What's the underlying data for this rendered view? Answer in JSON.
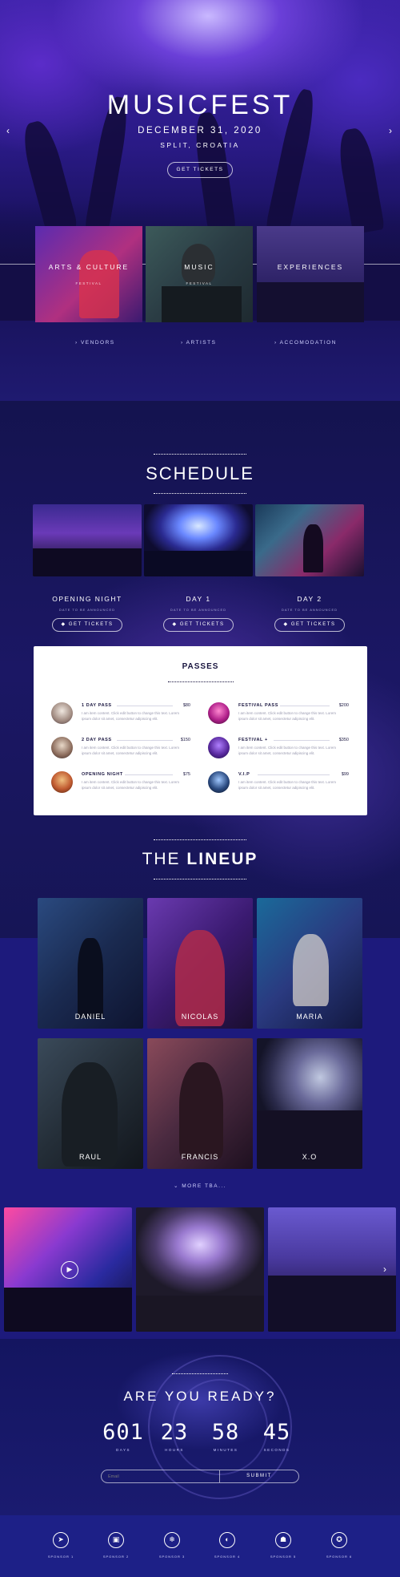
{
  "hero": {
    "title": "MUSICFEST",
    "date": "DECEMBER 31, 2020",
    "location": "SPLIT, CROATIA",
    "cta": "GET TICKETS",
    "prev_icon": "chevron-left-icon",
    "next_icon": "chevron-right-icon"
  },
  "categories": [
    {
      "label": "ARTS & CULTURE",
      "sub": "FESTIVAL"
    },
    {
      "label": "MUSIC",
      "sub": "FESTIVAL"
    },
    {
      "label": "EXPERIENCES",
      "sub": ""
    }
  ],
  "nav_links": [
    {
      "label": "› VENDORS"
    },
    {
      "label": "› ARTISTS"
    },
    {
      "label": "› ACCOMODATION"
    }
  ],
  "schedule": {
    "title": "SCHEDULE",
    "days": [
      {
        "title": "OPENING NIGHT",
        "sub": "DATE TO BE ANNOUNCED",
        "btn": "GET TICKETS"
      },
      {
        "title": "DAY 1",
        "sub": "DATE TO BE ANNOUNCED",
        "btn": "GET TICKETS"
      },
      {
        "title": "DAY 2",
        "sub": "DATE TO BE ANNOUNCED",
        "btn": "GET TICKETS"
      }
    ]
  },
  "passes": {
    "title": "PASSES",
    "items": [
      {
        "name": "1 DAY PASS",
        "price": "$80",
        "desc": "I am item content. Click edit button to change this text. Lorem ipsum dolor sit amet, consectetur adipiscing elit."
      },
      {
        "name": "FESTIVAL PASS",
        "price": "$200",
        "desc": "I am item content. Click edit button to change this text. Lorem ipsum dolor sit amet, consectetur adipiscing elit."
      },
      {
        "name": "2 DAY PASS",
        "price": "$150",
        "desc": "I am item content. Click edit button to change this text. Lorem ipsum dolor sit amet, consectetur adipiscing elit."
      },
      {
        "name": "FESTIVAL +",
        "price": "$350",
        "desc": "I am item content. Click edit button to change this text. Lorem ipsum dolor sit amet, consectetur adipiscing elit."
      },
      {
        "name": "OPENING NIGHT",
        "price": "$75",
        "desc": "I am item content. Click edit button to change this text. Lorem ipsum dolor sit amet, consectetur adipiscing elit."
      },
      {
        "name": "V.I.P",
        "price": "$99",
        "desc": "I am item content. Click edit button to change this text. Lorem ipsum dolor sit amet, consectetur adipiscing elit."
      }
    ]
  },
  "lineup": {
    "title_light": "THE ",
    "title_bold": "LINEUP",
    "artists": [
      "DANIEL",
      "NICOLAS",
      "MARIA",
      "RAUL",
      "FRANCIS",
      "X.O"
    ],
    "more": "⌄ MORE TBA..."
  },
  "gallery": {
    "play_icon": "play-icon",
    "next_icon": "chevron-right-icon"
  },
  "countdown": {
    "title": "ARE YOU READY?",
    "units": [
      {
        "value": "601",
        "label": "DAYS"
      },
      {
        "value": "23",
        "label": "HOURS"
      },
      {
        "value": "58",
        "label": "MINUTES"
      },
      {
        "value": "45",
        "label": "SECONDS"
      }
    ],
    "email_placeholder": "Email",
    "submit": "SUBMIT"
  },
  "sponsors": [
    {
      "label": "SPONSOR 1",
      "icon": "sponsor-1-icon"
    },
    {
      "label": "SPONSOR 2",
      "icon": "sponsor-2-icon"
    },
    {
      "label": "SPONSOR 3",
      "icon": "sponsor-3-icon"
    },
    {
      "label": "SPONSOR 4",
      "icon": "sponsor-4-icon"
    },
    {
      "label": "SPONSOR 5",
      "icon": "sponsor-5-icon"
    },
    {
      "label": "SPONSOR 6",
      "icon": "sponsor-6-icon"
    }
  ]
}
